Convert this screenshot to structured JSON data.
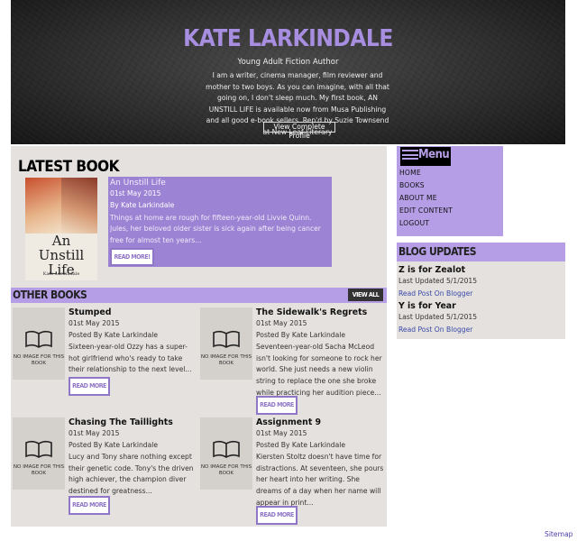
{
  "header": {
    "title": "KATE LARKINDALE",
    "subtitle": "Young Adult Fiction Author",
    "bio": "I am a writer, cinema manager, film reviewer and mother to two boys. As you can imagine, with all that going on, I don't sleep much. My first book, AN UNSTILL LIFE is available now from Musa Publishing and all good e-book sellers. Rep'd by Suzie Townsend at New Leaf Literary",
    "profile_button": "View Complete Profile"
  },
  "latest_book": {
    "section_title": "LATEST BOOK",
    "cover_title": "An\nUnstill\nLife",
    "cover_author": "Kate Larkindale",
    "title": "An Unstill Life",
    "date": "01st May 2015",
    "author": "By Kate Larkindale",
    "excerpt": "Things at home are rough for fifteen-year-old Livvie Quinn. Jules, her beloved older sister is sick again after being cancer free for almost ten years...",
    "read_more": "READ MORE!"
  },
  "other_books": {
    "section_title": "OTHER BOOKS",
    "view_all": "VIEW ALL",
    "no_image_text": "NO IMAGE FOR THIS BOOK",
    "read_more": "READ MORE",
    "items": [
      {
        "title": "Stumped",
        "date": "01st May 2015",
        "author": "Posted By Kate Larkindale",
        "excerpt": "Sixteen-year-old Ozzy has a super-hot girlfriend who's ready to take their relationship to the next level..."
      },
      {
        "title": "The Sidewalk's Regrets",
        "date": "01st May 2015",
        "author": "Posted By Kate Larkindale",
        "excerpt": "Seventeen-year-old Sacha McLeod isn't looking for someone to rock her world. She just needs a new violin string to replace the one she broke while practicing her audition piece..."
      },
      {
        "title": "Chasing The Taillights",
        "date": "01st May 2015",
        "author": "Posted By Kate Larkindale",
        "excerpt": "Lucy and Tony share nothing except their genetic code. Tony's the driven high achiever, the champion diver destined for greatness..."
      },
      {
        "title": "Assignment 9",
        "date": "01st May 2015",
        "author": "Posted By Kate Larkindale",
        "excerpt": "Kiersten Stoltz doesn't have time for distractions. At seventeen, she pours her heart into her writing. She dreams of a day when her name will appear in print..."
      }
    ]
  },
  "nav": {
    "menu_label": "Menu",
    "items": [
      "HOME",
      "BOOKS",
      "ABOUT ME",
      "EDIT CONTENT",
      "LOGOUT"
    ]
  },
  "blog": {
    "title": "BLOG UPDATES",
    "posts": [
      {
        "title": "Z is for Zealot",
        "updated": "Last Updated 5/1/2015",
        "link": "Read Post On Blogger"
      },
      {
        "title": "Y is for Year",
        "updated": "Last Updated 5/1/2015",
        "link": "Read Post On Blogger"
      }
    ]
  },
  "footer": {
    "sitemap": "Sitemap"
  },
  "colors": {
    "accent": "#b59ee6",
    "accent_dark": "#9d83d4",
    "panel": "#e4e1de",
    "link": "#3a4aa8"
  },
  "icons": {
    "menu": "hamburger-icon",
    "no_image": "open-book-icon"
  }
}
